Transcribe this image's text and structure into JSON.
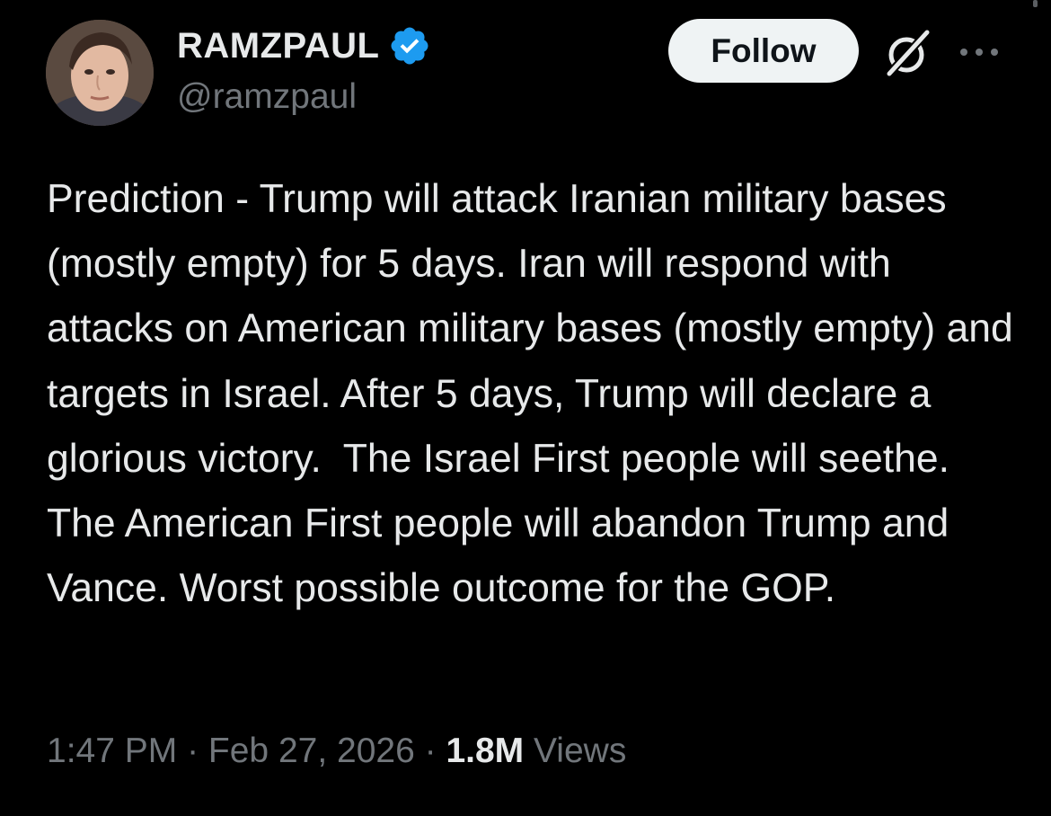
{
  "author": {
    "display_name": "RAMZPAUL",
    "handle": "@ramzpaul",
    "verified": true
  },
  "actions": {
    "follow_label": "Follow",
    "grok_icon": "grok-icon",
    "more_icon": "more-icon"
  },
  "tweet": {
    "text": "Prediction - Trump will attack Iranian military bases (mostly empty) for 5 days. Iran will respond with attacks on American military bases (mostly empty) and targets in Israel. After 5 days, Trump will declare a glorious victory.  The Israel First people will seethe. The American First people will abandon Trump and Vance. Worst possible outcome for the GOP."
  },
  "meta": {
    "time": "1:47 PM",
    "separator": " · ",
    "date": "Feb 27, 2026",
    "views_count": "1.8M",
    "views_label": " Views"
  },
  "colors": {
    "background": "#000000",
    "text_primary": "#e7e9ea",
    "text_secondary": "#71767b",
    "verified_blue": "#1d9bf0",
    "follow_bg": "#eff3f4"
  }
}
